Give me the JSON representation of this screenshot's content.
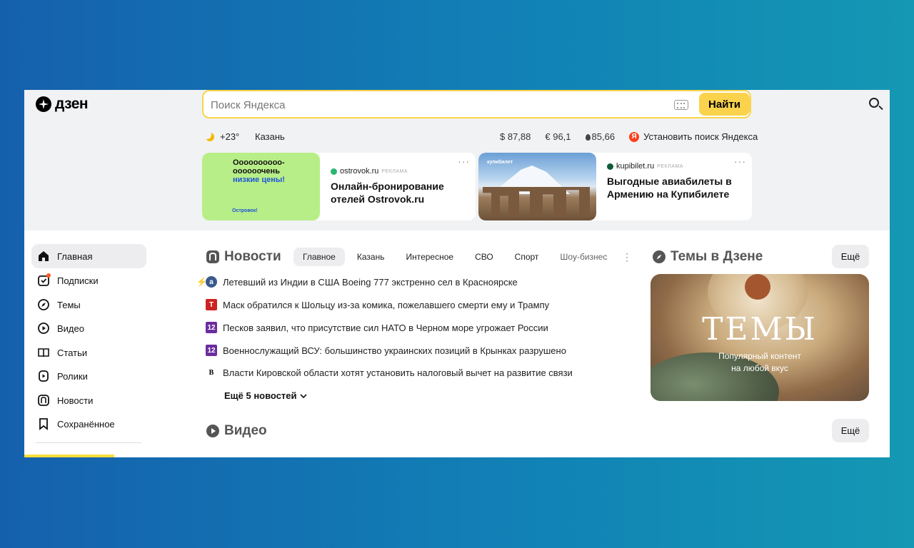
{
  "header": {
    "logo_text": "дзен",
    "search_placeholder": "Поиск Яндекса",
    "search_button": "Найти"
  },
  "info_bar": {
    "temperature": "+23°",
    "city": "Казань",
    "usd": "$ 87,88",
    "eur": "€ 96,1",
    "oil": "85,66",
    "install_search": "Установить поиск Яндекса"
  },
  "ads": [
    {
      "image_text_1": "Оооооооооо-\nоооооочень",
      "image_text_2": "низкие цены!",
      "image_brand": "Островок!",
      "source": "ostrovok.ru",
      "label": "РЕКЛАМА",
      "title": "Онлайн-бронирование отелей Ostrovok.ru"
    },
    {
      "image_brand": "купибилет",
      "source": "kupibilet.ru",
      "label": "РЕКЛАМА",
      "title": "Выгодные авиабилеты в Армению на Купибилете"
    }
  ],
  "sidebar": {
    "items": [
      {
        "label": "Главная",
        "icon": "home-icon",
        "active": true
      },
      {
        "label": "Подписки",
        "icon": "subscriptions-icon",
        "active": false
      },
      {
        "label": "Темы",
        "icon": "compass-icon",
        "active": false
      },
      {
        "label": "Видео",
        "icon": "video-icon",
        "active": false
      },
      {
        "label": "Статьи",
        "icon": "book-icon",
        "active": false
      },
      {
        "label": "Ролики",
        "icon": "clips-icon",
        "active": false
      },
      {
        "label": "Новости",
        "icon": "news-icon",
        "active": false
      },
      {
        "label": "Сохранённое",
        "icon": "bookmark-icon",
        "active": false
      }
    ]
  },
  "news": {
    "title": "Новости",
    "tabs": [
      "Главное",
      "Казань",
      "Интересное",
      "СВО",
      "Спорт",
      "Шоу-бизнес"
    ],
    "active_tab": "Главное",
    "items": [
      {
        "text": "Летевший из Индии в США Boeing 777 экстренно сел в Красноярске",
        "source_icon": "а",
        "breaking": true
      },
      {
        "text": "Маск обратился к Шольцу из-за комика, пожелавшего смерти ему и Трампу",
        "source_icon": "Т",
        "breaking": false
      },
      {
        "text": "Песков заявил, что присутствие сил НАТО в Черном море угрожает России",
        "source_icon": "12",
        "breaking": false
      },
      {
        "text": "Военнослужащий ВСУ: большинство украинских позиций в Крынках разрушено",
        "source_icon": "12",
        "breaking": false
      },
      {
        "text": "Власти Кировской области хотят установить налоговый вычет на развитие связи",
        "source_icon": "В",
        "breaking": false
      }
    ],
    "more": "Ещё 5 новостей"
  },
  "topics": {
    "title": "Темы в Дзене",
    "more_button": "Ещё",
    "card_title": "ТЕМЫ",
    "card_sub_1": "Популярный контент",
    "card_sub_2": "на любой вкус"
  },
  "video": {
    "title": "Видео",
    "more_button": "Ещё"
  },
  "colors": {
    "accent_yellow": "#fad24c",
    "yandex_red": "#fc3f1d",
    "notification": "#ff5722"
  }
}
